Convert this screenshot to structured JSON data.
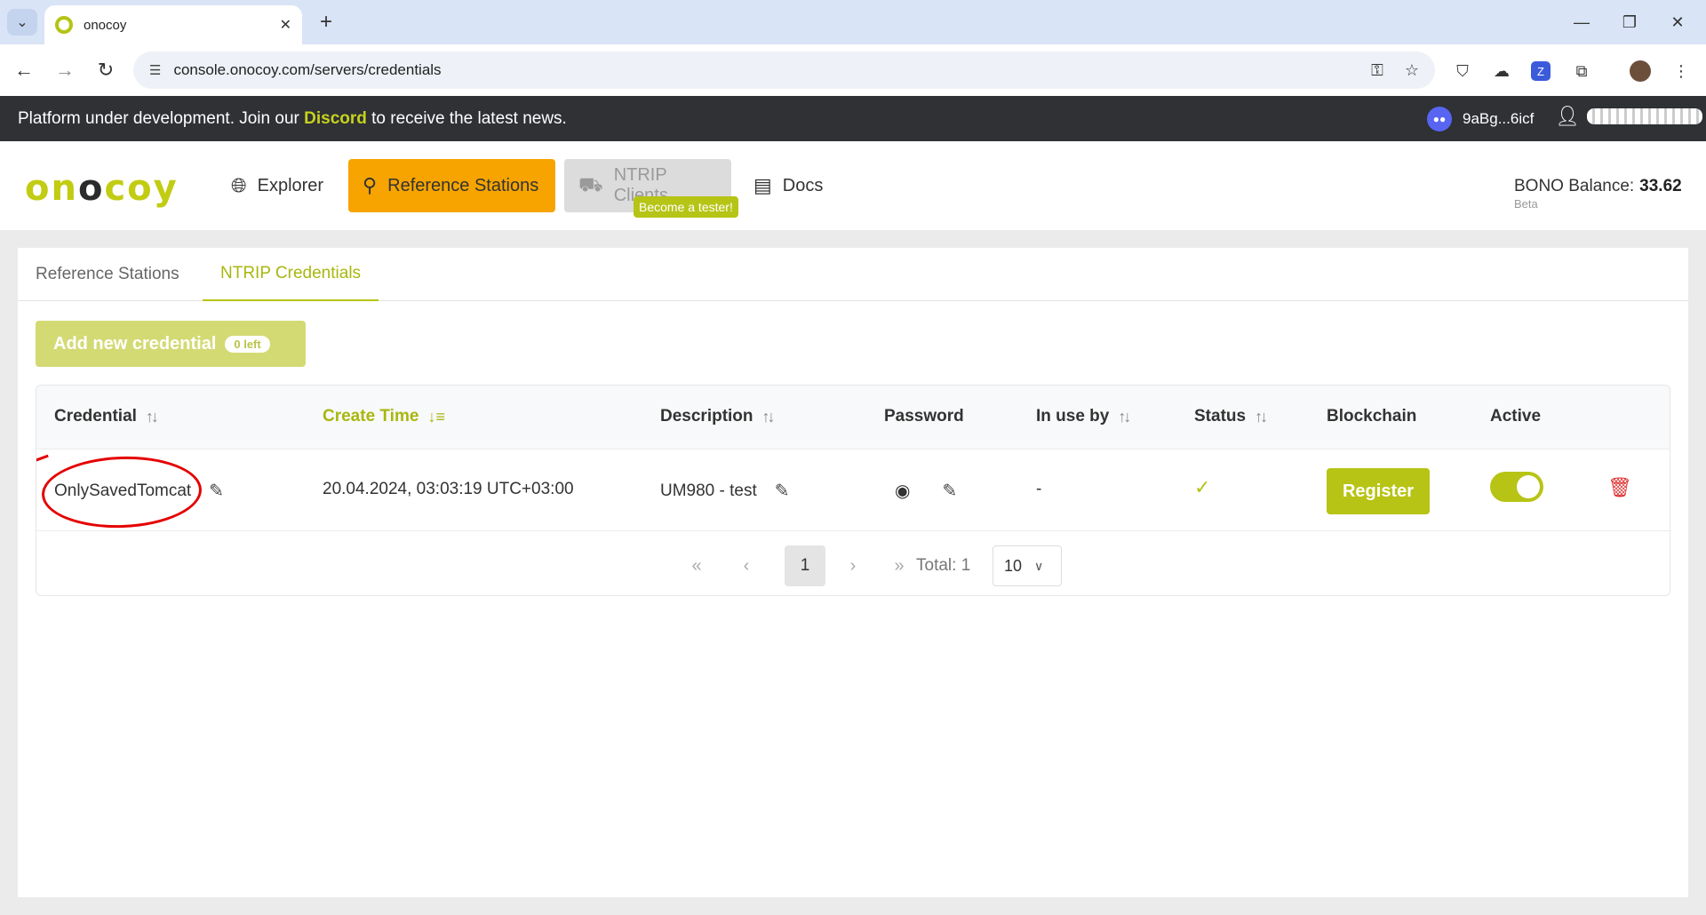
{
  "browser": {
    "tab_title": "onocoy",
    "tab_close": "✕",
    "new_tab": "+",
    "url": "console.onocoy.com/servers/credentials"
  },
  "banner": {
    "text_before": "Platform under development. Join our ",
    "link": "Discord",
    "text_after": " to receive the latest news.",
    "wallet": "9aBg...6icf"
  },
  "header": {
    "logo_left": "on",
    "logo_mid": "o",
    "logo_right": "coy",
    "nav": {
      "explorer": "Explorer",
      "reference_stations": "Reference Stations",
      "ntrip_clients": "NTRIP Clients",
      "tester_badge": "Become a tester!",
      "docs": "Docs"
    },
    "balance_label": "BONO Balance:",
    "balance_value": "33.62",
    "balance_sub": "Beta"
  },
  "page": {
    "tabs": [
      "Reference Stations",
      "NTRIP Credentials"
    ],
    "add_button": "Add new credential",
    "add_badge": "0 left"
  },
  "table": {
    "columns": {
      "credential": "Credential",
      "create_time": "Create Time",
      "description": "Description",
      "password": "Password",
      "in_use_by": "In use by",
      "status": "Status",
      "blockchain": "Blockchain",
      "active": "Active"
    },
    "rows": [
      {
        "credential": "OnlySavedTomcat",
        "create_time": "20.04.2024, 03:03:19 UTC+03:00",
        "description": "UM980 - test",
        "in_use_by": "-",
        "register": "Register",
        "active": true
      }
    ]
  },
  "pagination": {
    "current": "1",
    "total": "Total: 1",
    "page_size": "10"
  },
  "colors": {
    "brand": "#b7c415",
    "accent_orange": "#f7a400",
    "danger": "#e03131"
  }
}
